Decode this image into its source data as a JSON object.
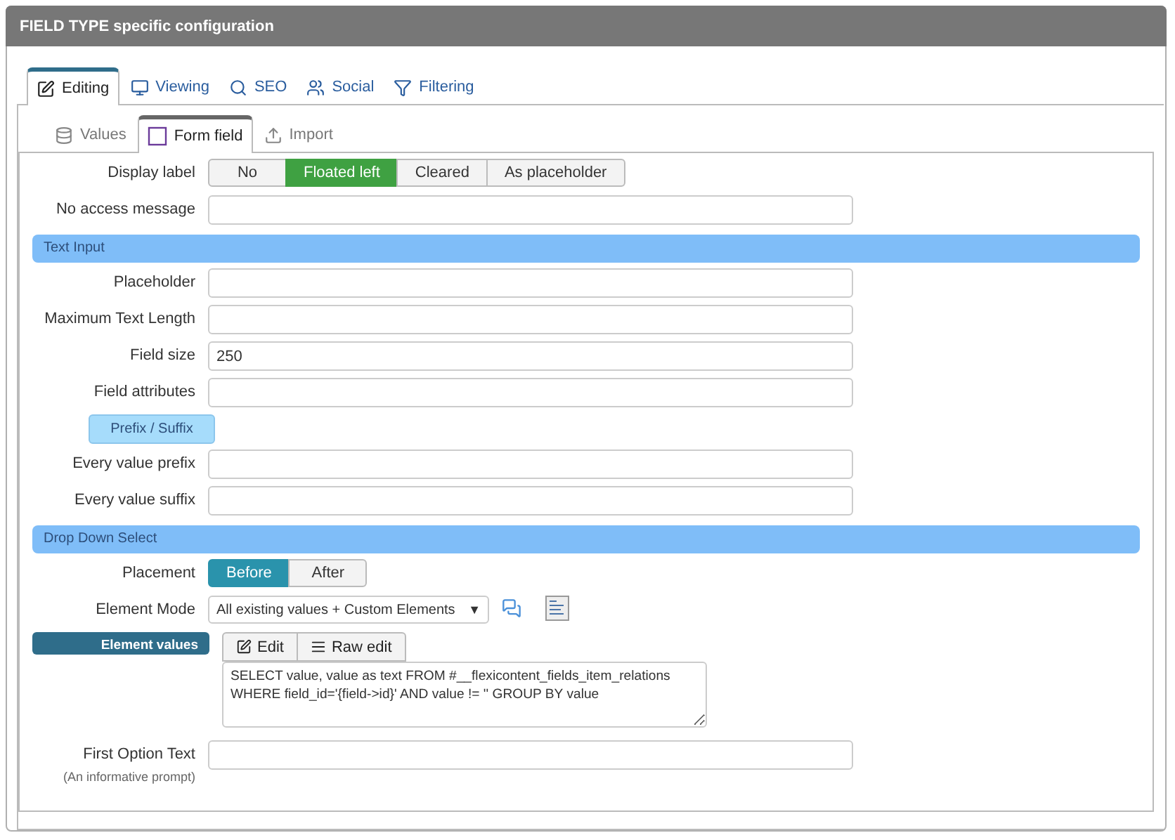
{
  "header": {
    "title": "FIELD TYPE specific configuration"
  },
  "tabs": [
    {
      "label": "Editing",
      "selected": true
    },
    {
      "label": "Viewing",
      "selected": false
    },
    {
      "label": "SEO",
      "selected": false
    },
    {
      "label": "Social",
      "selected": false
    },
    {
      "label": "Filtering",
      "selected": false
    }
  ],
  "subtabs": [
    {
      "label": "Values",
      "selected": false
    },
    {
      "label": "Form field",
      "selected": true
    },
    {
      "label": "Import",
      "selected": false
    }
  ],
  "rows": [
    {
      "kind": "choice",
      "label": "Display label",
      "color": "#3fa142",
      "options": [
        {
          "label": "No",
          "selected": false
        },
        {
          "label": "Floated left",
          "selected": true
        },
        {
          "label": "Cleared",
          "selected": false
        },
        {
          "label": "As placeholder",
          "selected": false
        }
      ]
    },
    {
      "kind": "input",
      "label": "No access message"
    },
    {
      "kind": "section",
      "label": "Text Input"
    },
    {
      "kind": "input",
      "label": "Placeholder"
    },
    {
      "kind": "input",
      "label": "Maximum Text Length"
    },
    {
      "kind": "input",
      "label": "Field size",
      "value": "250"
    },
    {
      "kind": "input",
      "label": "Field attributes"
    },
    {
      "kind": "group",
      "label": "Prefix / Suffix"
    },
    {
      "kind": "input",
      "label": "Every value prefix"
    },
    {
      "kind": "input",
      "label": "Every value suffix"
    },
    {
      "kind": "section",
      "label": "Drop Down Select"
    },
    {
      "kind": "choice",
      "label": "Placement",
      "color": "#2a93ac",
      "options": [
        {
          "label": "Before",
          "selected": true
        },
        {
          "label": "After",
          "selected": false
        }
      ]
    },
    {
      "kind": "select",
      "label": "Element Mode",
      "value": "All existing values + Custom Elements",
      "arrow": "▼"
    },
    {
      "kind": "editor",
      "label": "Element values",
      "buttons": [
        {
          "label": "Edit"
        },
        {
          "label": "Raw edit"
        }
      ],
      "value": "SELECT value, value as text FROM #__flexicontent_fields_item_relations\nWHERE field_id='{field->id}' AND value != '' GROUP BY value"
    },
    {
      "kind": "input",
      "label": "First Option Text",
      "note": "(An informative prompt)"
    }
  ]
}
